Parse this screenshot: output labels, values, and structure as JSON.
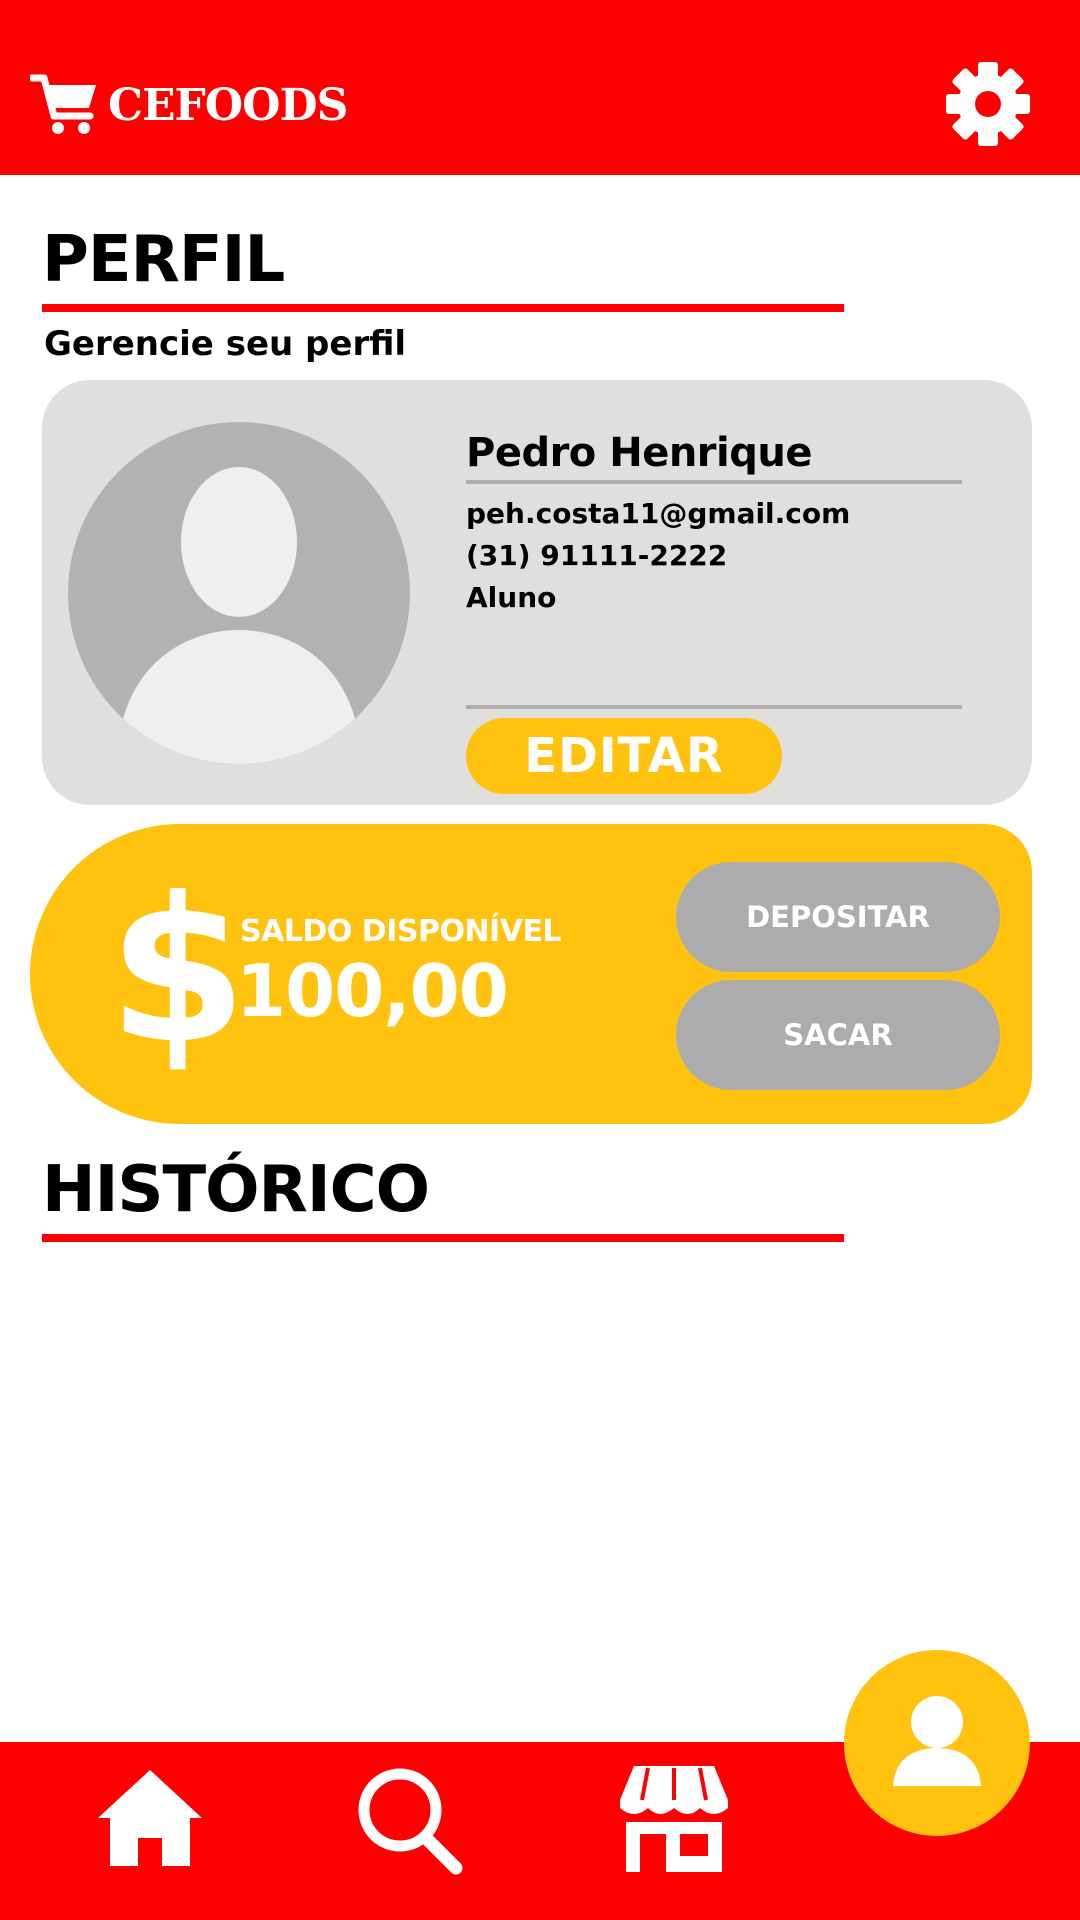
{
  "header": {
    "brand": "CEFOODS",
    "cart_icon": "shopping-cart-icon",
    "settings_icon": "gear-icon"
  },
  "profile_section": {
    "title": "PERFIL",
    "subtitle": "Gerencie seu perfil"
  },
  "profile_card": {
    "name": "Pedro Henrique",
    "email": "peh.costa11@gmail.com",
    "phone": "(31) 91111-2222",
    "role": "Aluno",
    "edit_label": "EDITAR",
    "avatar_icon": "user-avatar-icon"
  },
  "balance": {
    "currency_symbol": "$",
    "label": "SALDO DISPONÍVEL",
    "value": "100,00",
    "deposit_label": "DEPOSITAR",
    "withdraw_label": "SACAR"
  },
  "history_section": {
    "title": "HISTÓRICO"
  },
  "bottom_nav": {
    "items": [
      "home-icon",
      "search-icon",
      "store-icon",
      "user-icon"
    ],
    "active": "user-icon"
  },
  "colors": {
    "primary_red": "#ff0000",
    "accent_yellow": "#ffc20e",
    "card_gray": "#e1dfde",
    "button_gray": "#acacac",
    "text_black": "#000000",
    "text_white": "#ffffff"
  }
}
